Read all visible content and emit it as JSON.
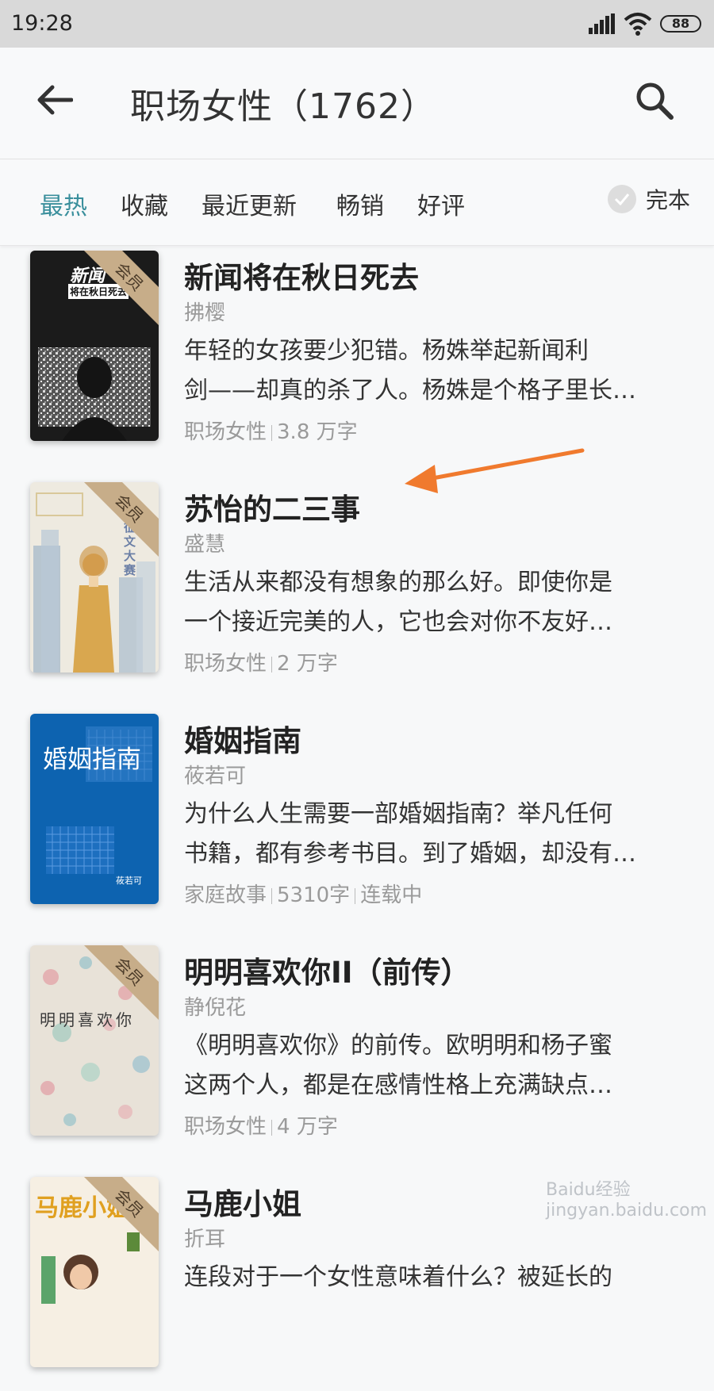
{
  "status_bar": {
    "time": "19:28",
    "battery": "88"
  },
  "app_bar": {
    "title": "职场女性（1762）"
  },
  "filters": {
    "tabs": [
      "最热",
      "收藏",
      "最近更新",
      "畅销",
      "好评"
    ],
    "active_index": 0,
    "complete_label": "完本"
  },
  "books": [
    {
      "title": "新闻将在秋日死去",
      "author": "拂樱",
      "desc": [
        "年轻的女孩要少犯错。杨姝举起新闻利",
        "剑——却真的杀了人。杨姝是个格子里长…"
      ],
      "meta": [
        "职场女性",
        "3.8 万字"
      ],
      "badge": "会员",
      "cover_text": [
        "新闻",
        "将在秋日死去"
      ]
    },
    {
      "title": "苏怡的二三事",
      "author": "盛慧",
      "desc": [
        "生活从来都没有想象的那么好。即使你是",
        "一个接近完美的人，它也会对你不友好…"
      ],
      "meta": [
        "职场女性",
        "2 万字"
      ],
      "badge": "会员",
      "cover_text": [
        "征文大赛"
      ]
    },
    {
      "title": "婚姻指南",
      "author": "莜若可",
      "desc": [
        "为什么人生需要一部婚姻指南？举凡任何",
        "书籍，都有参考书目。到了婚姻，却没有…"
      ],
      "meta": [
        "家庭故事",
        "5310字",
        "连载中"
      ],
      "badge": "",
      "cover_text": [
        "婚姻指南",
        "莜若可"
      ]
    },
    {
      "title": "明明喜欢你II（前传）",
      "author": "静倪花",
      "desc": [
        "《明明喜欢你》的前传。欧明明和杨子蜜",
        "这两个人，都是在感情性格上充满缺点…"
      ],
      "meta": [
        "职场女性",
        "4 万字"
      ],
      "badge": "会员",
      "cover_text": [
        "明明喜欢你"
      ]
    },
    {
      "title": "马鹿小姐",
      "author": "折耳",
      "desc": [
        "连段对于一个女性意味着什么？被延长的"
      ],
      "meta": [],
      "badge": "会员",
      "cover_text": [
        "马鹿小姐"
      ]
    }
  ],
  "watermark": "Baidu经验 jingyan.baidu.com"
}
